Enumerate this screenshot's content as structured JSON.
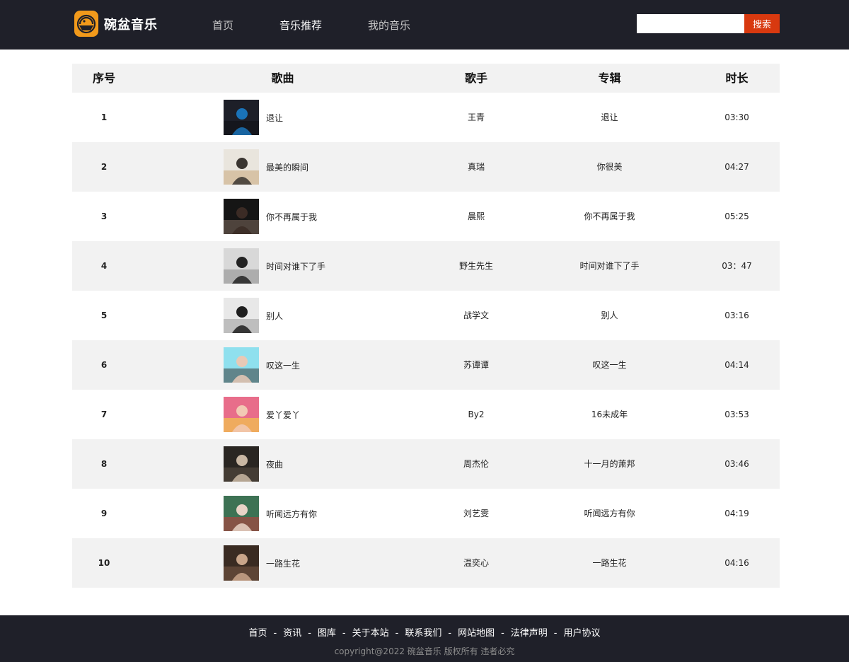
{
  "brand": {
    "name": "碗盆音乐",
    "logo_color": "#f29a1b"
  },
  "nav": {
    "items": [
      {
        "label": "首页",
        "active": false
      },
      {
        "label": "音乐推荐",
        "active": true
      },
      {
        "label": "我的音乐",
        "active": false
      }
    ]
  },
  "search": {
    "value": "",
    "placeholder": "",
    "button_label": "搜索",
    "button_color": "#d8390f"
  },
  "table": {
    "headers": {
      "index": "序号",
      "song": "歌曲",
      "artist": "歌手",
      "album": "专辑",
      "duration": "时长"
    },
    "rows": [
      {
        "index": "1",
        "song": "退让",
        "artist": "王青",
        "album": "退让",
        "duration": "03:30",
        "cover": "blue-dark"
      },
      {
        "index": "2",
        "song": "最美的瞬间",
        "artist": "真瑞",
        "album": "你很美",
        "duration": "04:27",
        "cover": "guitar-light"
      },
      {
        "index": "3",
        "song": "你不再属于我",
        "artist": "晨熙",
        "album": "你不再属于我",
        "duration": "05:25",
        "cover": "dark-portrait"
      },
      {
        "index": "4",
        "song": "时间对谁下了手",
        "artist": "野生先生",
        "album": "时间对谁下了手",
        "duration": "03：47",
        "cover": "bw-portrait"
      },
      {
        "index": "5",
        "song": "别人",
        "artist": "战学文",
        "album": "别人",
        "duration": "03:16",
        "cover": "bw-street"
      },
      {
        "index": "6",
        "song": "叹这一生",
        "artist": "苏谭谭",
        "album": "叹这一生",
        "duration": "04:14",
        "cover": "cyan-portrait"
      },
      {
        "index": "7",
        "song": "爱丫爱丫",
        "artist": "By2",
        "album": "16未成年",
        "duration": "03:53",
        "cover": "pink-duo"
      },
      {
        "index": "8",
        "song": "夜曲",
        "artist": "周杰伦",
        "album": "十一月的萧邦",
        "duration": "03:46",
        "cover": "sepia-dark"
      },
      {
        "index": "9",
        "song": "听闻远方有你",
        "artist": "刘艺雯",
        "album": "听闻远方有你",
        "duration": "04:19",
        "cover": "green-portrait"
      },
      {
        "index": "10",
        "song": "一路生花",
        "artist": "温奕心",
        "album": "一路生花",
        "duration": "04:16",
        "cover": "warm-portrait"
      }
    ]
  },
  "footer": {
    "links": [
      "首页",
      "资讯",
      "图库",
      "关于本站",
      "联系我们",
      "网站地图",
      "法律声明",
      "用户协议"
    ],
    "separator": "-",
    "copyright": "copyright@2022 碗盆音乐 版权所有 违者必究"
  },
  "colors": {
    "header_bg": "#1f2029",
    "row_alt_bg": "#f2f2f2",
    "accent": "#d8390f"
  }
}
